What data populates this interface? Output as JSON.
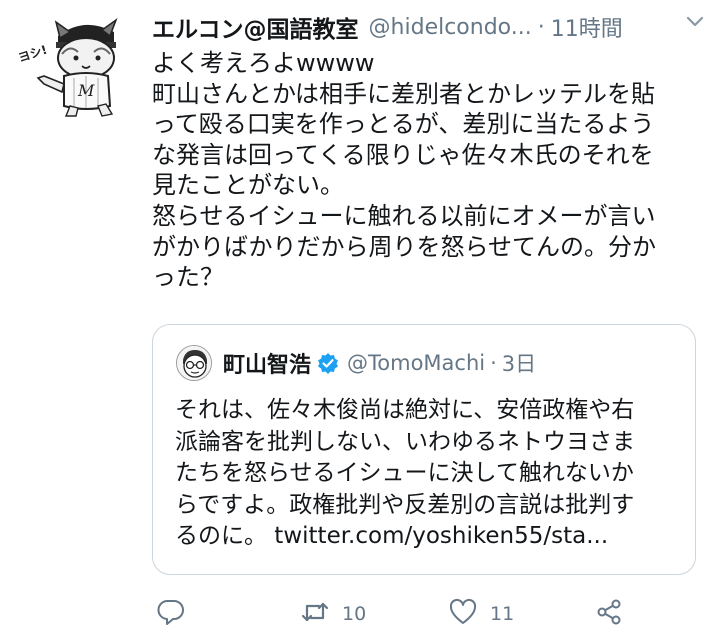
{
  "tweet": {
    "display_name": "エルコン@国語教室",
    "handle": "@hidelcondo...",
    "separator": "·",
    "time": "11時間",
    "avatar_text": "ヨシ!",
    "lines": [
      "よく考えろよwwww",
      "町山さんとかは相手に差別者とかレッテルを貼",
      "って殴る口実を作っとるが、差別に当たるよう",
      "な発言は回ってくる限りじゃ佐々木氏のそれを",
      "見たことがない。",
      "怒らせるイシューに触れる以前にオメーが言い",
      "がかりばかりだから周りを怒らせてんの。分か",
      "った？"
    ]
  },
  "quote": {
    "display_name": "町山智浩",
    "handle": "@TomoMachi",
    "separator": "·",
    "time": "3日",
    "lines": [
      "それは、佐々木俊尚は絶対に、安倍政権や右",
      "派論客を批判しない、いわゆるネトウヨさま",
      "たちを怒らせるイシューに決して触れないか",
      "らですよ。政権批判や反差別の言説は批判す",
      "るのに。 twitter.com/yoshiken55/sta..."
    ]
  },
  "actions": {
    "retweet_count": "10",
    "like_count": "11"
  },
  "colors": {
    "text": "#14171a",
    "secondary": "#657786",
    "verified": "#1da1f2",
    "border": "#cdd6dd"
  },
  "icons": [
    "reply-icon",
    "retweet-icon",
    "like-icon",
    "share-icon",
    "chevron-down-icon",
    "verified-badge-icon"
  ]
}
